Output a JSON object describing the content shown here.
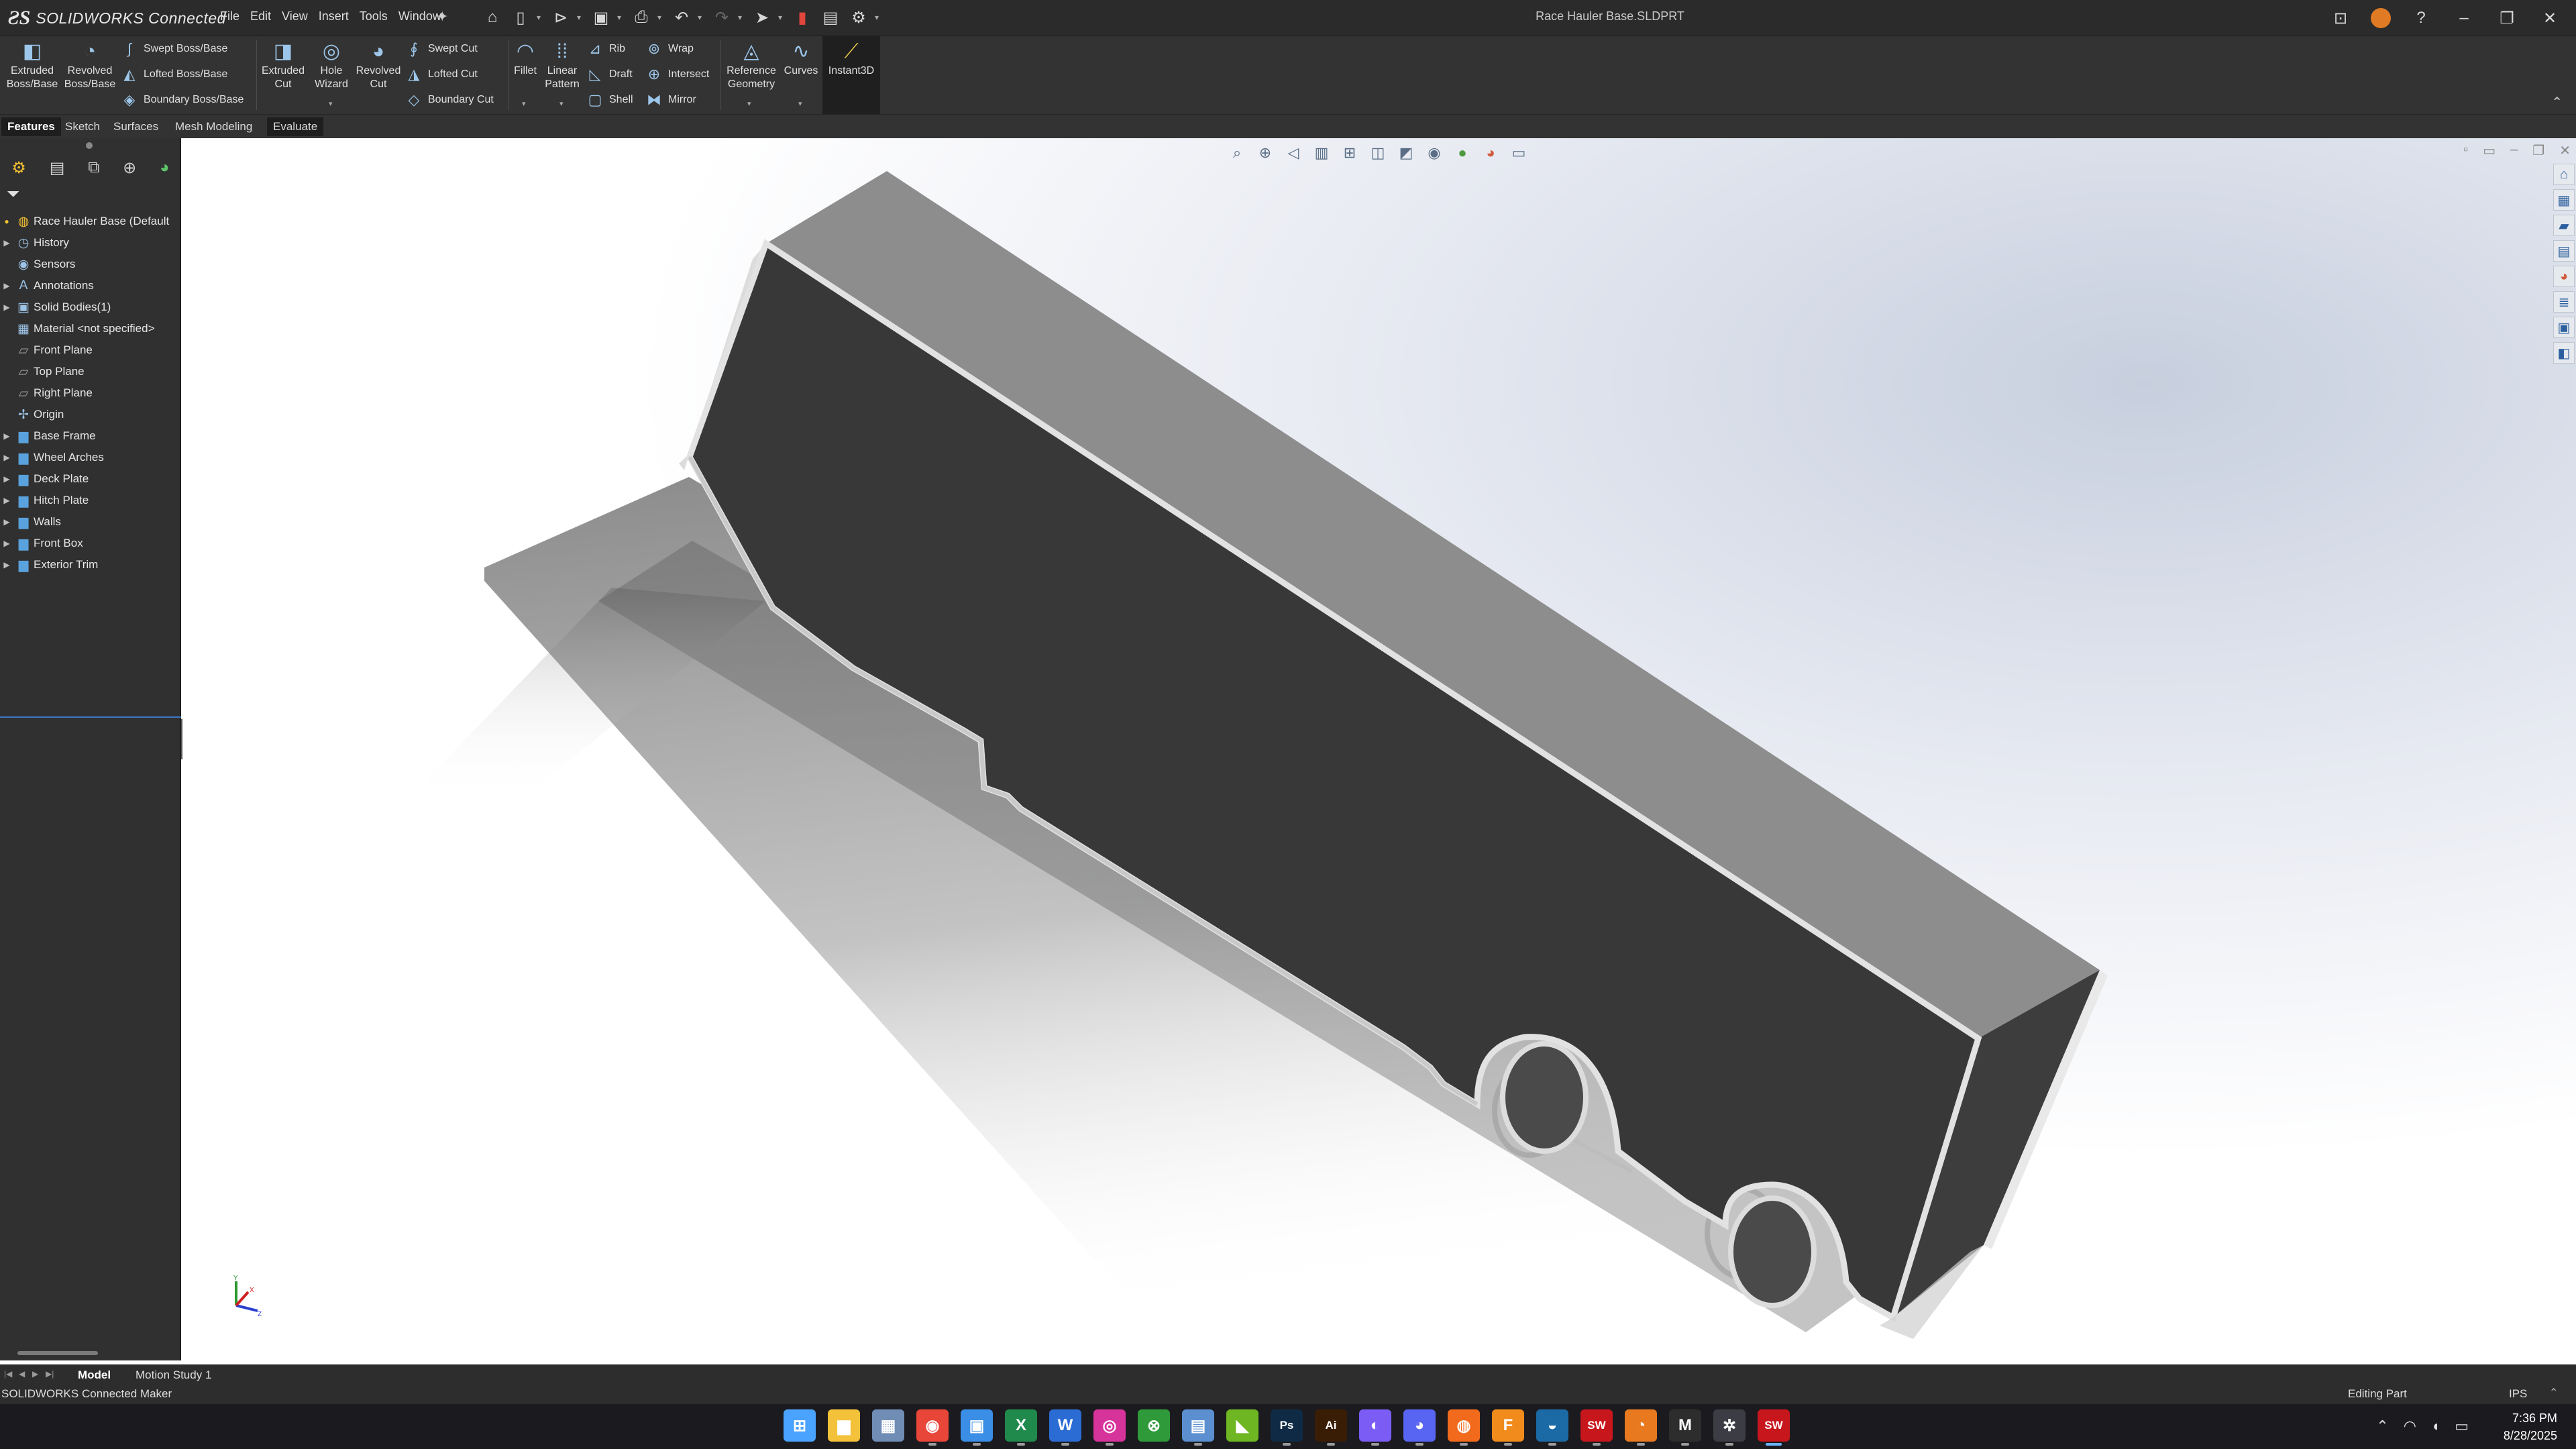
{
  "titlebar": {
    "brand": "SOLIDWORKS Connected",
    "menu": [
      "File",
      "Edit",
      "View",
      "Insert",
      "Tools",
      "Window"
    ],
    "document_title": "Race Hauler Base.SLDPRT"
  },
  "ribbon": {
    "extruded_boss": "Extruded Boss/Base",
    "revolved_boss": "Revolved Boss/Base",
    "swept_boss": "Swept Boss/Base",
    "lofted_boss": "Lofted Boss/Base",
    "boundary_boss": "Boundary Boss/Base",
    "extruded_cut": "Extruded Cut",
    "hole_wizard": "Hole Wizard",
    "revolved_cut": "Revolved Cut",
    "swept_cut": "Swept Cut",
    "lofted_cut": "Lofted Cut",
    "boundary_cut": "Boundary Cut",
    "fillet": "Fillet",
    "linear_pattern": "Linear Pattern",
    "rib": "Rib",
    "draft": "Draft",
    "shell": "Shell",
    "wrap": "Wrap",
    "intersect": "Intersect",
    "mirror": "Mirror",
    "reference_geometry": "Reference Geometry",
    "curves": "Curves",
    "instant3d": "Instant3D"
  },
  "tabs": [
    "Features",
    "Sketch",
    "Surfaces",
    "Mesh Modeling",
    "Evaluate"
  ],
  "active_tab": "Features",
  "tree": {
    "root": "Race Hauler Base (Default",
    "items": [
      {
        "label": "History",
        "icon": "history-icon",
        "expandable": true
      },
      {
        "label": "Sensors",
        "icon": "sensor-icon",
        "expandable": false
      },
      {
        "label": "Annotations",
        "icon": "annotation-icon",
        "expandable": true
      },
      {
        "label": "Solid Bodies(1)",
        "icon": "solid-bodies-icon",
        "expandable": true
      },
      {
        "label": "Material <not specified>",
        "icon": "material-icon",
        "expandable": false
      },
      {
        "label": "Front Plane",
        "icon": "plane-icon",
        "expandable": false
      },
      {
        "label": "Top Plane",
        "icon": "plane-icon",
        "expandable": false
      },
      {
        "label": "Right Plane",
        "icon": "plane-icon",
        "expandable": false
      },
      {
        "label": "Origin",
        "icon": "origin-icon",
        "expandable": false
      },
      {
        "label": "Base Frame",
        "icon": "folder-icon",
        "expandable": true
      },
      {
        "label": "Wheel Arches",
        "icon": "folder-icon",
        "expandable": true
      },
      {
        "label": "Deck Plate",
        "icon": "folder-icon",
        "expandable": true
      },
      {
        "label": "Hitch Plate",
        "icon": "folder-icon",
        "expandable": true
      },
      {
        "label": "Walls",
        "icon": "folder-icon",
        "expandable": true
      },
      {
        "label": "Front Box",
        "icon": "folder-icon",
        "expandable": true
      },
      {
        "label": "Exterior Trim",
        "icon": "folder-icon",
        "expandable": true
      }
    ]
  },
  "bottom_tabs": [
    "Model",
    "Motion Study 1"
  ],
  "active_bottom_tab": "Model",
  "status": {
    "left": "SOLIDWORKS Connected Maker",
    "mode": "Editing Part",
    "units": "IPS"
  },
  "taskbar": {
    "time": "7:36 PM",
    "date": "8/28/2025",
    "apps": [
      {
        "name": "windows-start-icon",
        "glyph": "⊞",
        "color": "#4aa3ff"
      },
      {
        "name": "file-explorer-icon",
        "glyph": "▆",
        "color": "#f3c23a"
      },
      {
        "name": "calculator-icon",
        "glyph": "▦",
        "color": "#6f8db5"
      },
      {
        "name": "chrome-icon",
        "glyph": "◉",
        "color": "#e9463a"
      },
      {
        "name": "microsoft-store-icon",
        "glyph": "▣",
        "color": "#3a8ee6"
      },
      {
        "name": "excel-icon",
        "glyph": "X",
        "color": "#1f8a4c"
      },
      {
        "name": "word-icon",
        "glyph": "W",
        "color": "#2b6cd4"
      },
      {
        "name": "instagram-icon",
        "glyph": "◎",
        "color": "#d6339b"
      },
      {
        "name": "xbox-icon",
        "glyph": "⊗",
        "color": "#2f9a3a"
      },
      {
        "name": "notepad-icon",
        "glyph": "▤",
        "color": "#5b8fd0"
      },
      {
        "name": "nvidia-icon",
        "glyph": "◣",
        "color": "#6fb623"
      },
      {
        "name": "photoshop-icon",
        "glyph": "Ps",
        "color": "#0f2a44"
      },
      {
        "name": "illustrator-icon",
        "glyph": "Ai",
        "color": "#3a1d05"
      },
      {
        "name": "messenger-icon",
        "glyph": "◐",
        "color": "#7b5cf5"
      },
      {
        "name": "discord-icon",
        "glyph": "◕",
        "color": "#5865f2"
      },
      {
        "name": "origin-app-icon",
        "glyph": "◍",
        "color": "#f26b1d"
      },
      {
        "name": "fusion-icon",
        "glyph": "F",
        "color": "#f08b1c"
      },
      {
        "name": "steam-icon",
        "glyph": "◒",
        "color": "#1b6aa5"
      },
      {
        "name": "solidworks-2025-icon",
        "glyph": "SW",
        "color": "#c8161d"
      },
      {
        "name": "blender-icon",
        "glyph": "◔",
        "color": "#e8791f"
      },
      {
        "name": "medium-icon",
        "glyph": "M",
        "color": "#2d2d2d"
      },
      {
        "name": "settings-icon",
        "glyph": "✲",
        "color": "#3c3c44"
      },
      {
        "name": "solidworks-connected-icon",
        "glyph": "SW",
        "color": "#c8161d"
      }
    ]
  }
}
